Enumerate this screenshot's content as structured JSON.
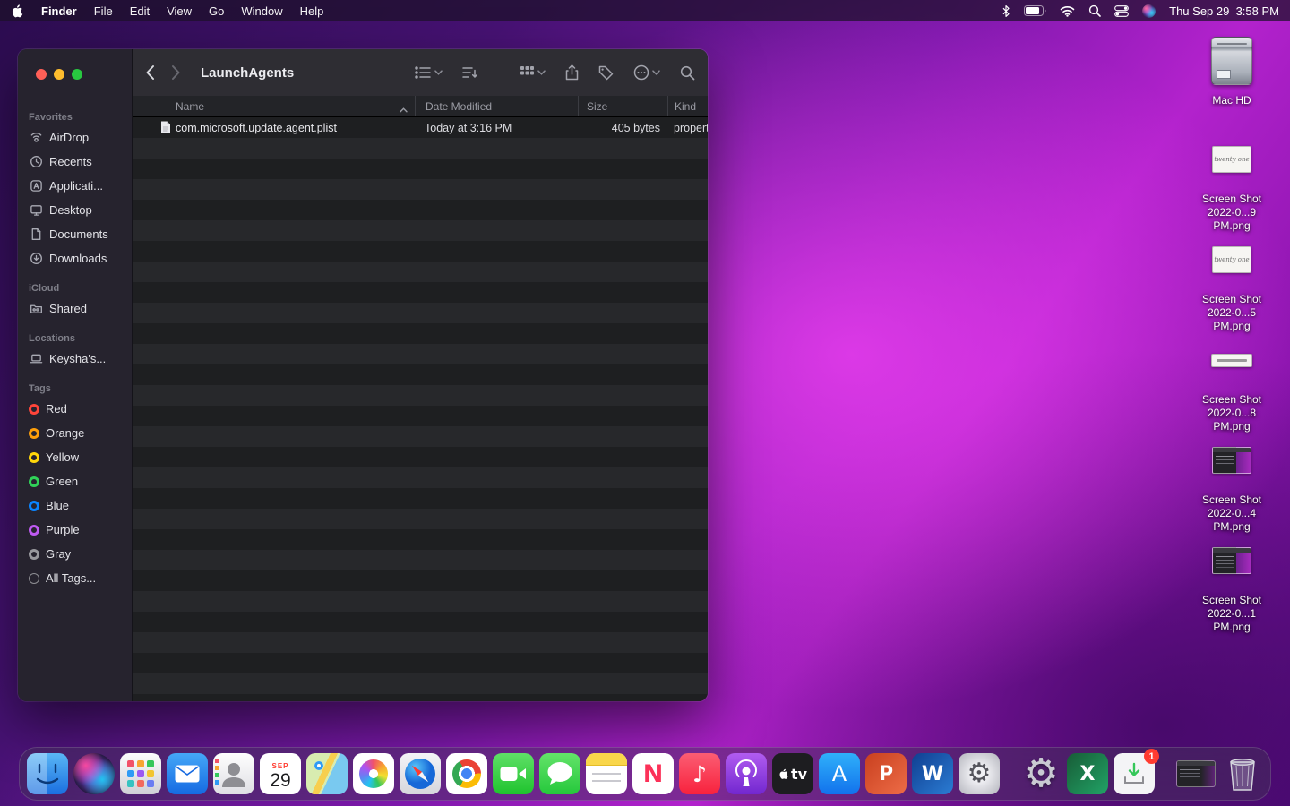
{
  "menu_bar": {
    "app_name": "Finder",
    "menus": [
      "File",
      "Edit",
      "View",
      "Go",
      "Window",
      "Help"
    ],
    "clock": "Thu Sep 29  3:58 PM"
  },
  "window": {
    "title": "LaunchAgents",
    "sidebar": {
      "favorites_title": "Favorites",
      "favorites": [
        "AirDrop",
        "Recents",
        "Applicati...",
        "Desktop",
        "Documents",
        "Downloads"
      ],
      "icloud_title": "iCloud",
      "icloud": [
        "Shared"
      ],
      "locations_title": "Locations",
      "locations": [
        "Keysha's..."
      ],
      "tags_title": "Tags",
      "tags": [
        {
          "label": "Red",
          "color": "#ff453a"
        },
        {
          "label": "Orange",
          "color": "#ff9f0a"
        },
        {
          "label": "Yellow",
          "color": "#ffd60a"
        },
        {
          "label": "Green",
          "color": "#30d158"
        },
        {
          "label": "Blue",
          "color": "#0a84ff"
        },
        {
          "label": "Purple",
          "color": "#bf5af2"
        },
        {
          "label": "Gray",
          "color": "#98989d"
        },
        {
          "label": "All Tags...",
          "color": "#8e8e93"
        }
      ]
    },
    "columns": {
      "name": "Name",
      "date": "Date Modified",
      "size": "Size",
      "kind": "Kind"
    },
    "files": [
      {
        "name": "com.microsoft.update.agent.plist",
        "date_modified": "Today at 3:16 PM",
        "size": "405 bytes",
        "kind": "property list"
      }
    ]
  },
  "desktop": {
    "volume_label": "Mac HD",
    "items": [
      {
        "line1": "Screen Shot",
        "line2": "2022-0...9 PM.png",
        "thumb_text": "twenty one"
      },
      {
        "line1": "Screen Shot",
        "line2": "2022-0...5 PM.png",
        "thumb_text": "twenty one"
      },
      {
        "line1": "Screen Shot",
        "line2": "2022-0...8 PM.png",
        "thumb_text": ""
      },
      {
        "line1": "Screen Shot",
        "line2": "2022-0...4 PM.png",
        "thumb_text": ""
      },
      {
        "line1": "Screen Shot",
        "line2": "2022-0...1 PM.png",
        "thumb_text": ""
      }
    ]
  },
  "dock": {
    "calendar": {
      "month": "SEP",
      "day": "29"
    },
    "glyphs": {
      "news": "N",
      "music": "♪",
      "appletv": "tv",
      "appstore": "A",
      "powerpoint": "P",
      "word": "W",
      "excel": "X",
      "sysprefs": "⚙",
      "gear": "⚙"
    },
    "badge": "1"
  },
  "colors": {
    "accent_magenta": "#b322cd",
    "traffic_red": "#ff5f57",
    "traffic_yellow": "#febc2e",
    "traffic_green": "#28c840"
  }
}
